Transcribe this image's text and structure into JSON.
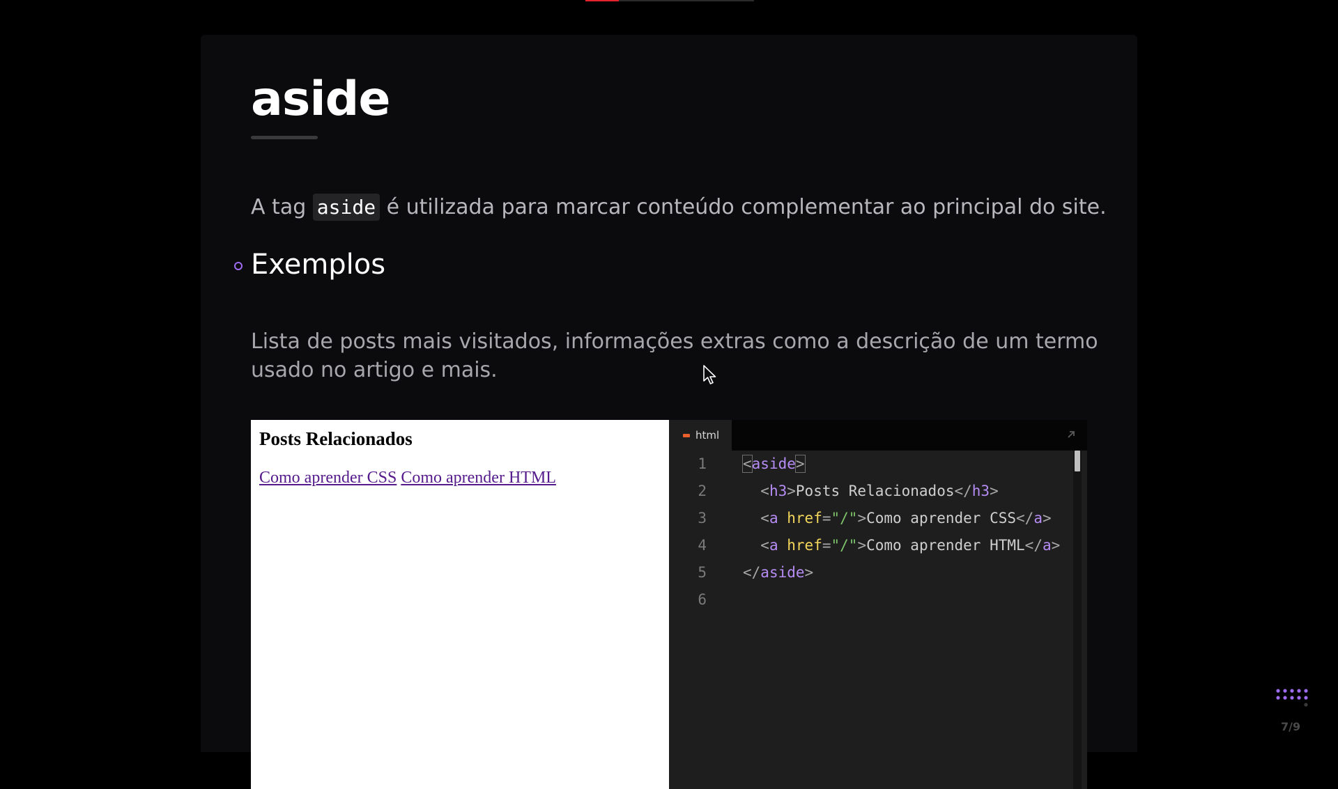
{
  "presentation": {
    "progress_fraction": 0.2,
    "accent_color": "#e5232d",
    "bullet_color": "#9d6cf0",
    "slide_counter": "7/9"
  },
  "slide": {
    "title": "aside",
    "intro_before": "A tag ",
    "intro_code": "aside",
    "intro_after": " é utilizada para marcar conteúdo complementar ao principal do site.",
    "section_heading": "Exemplos",
    "section_text": "Lista de posts mais visitados, informações extras como a descrição de um termo usado no artigo e mais."
  },
  "preview": {
    "heading": "Posts Relacionados",
    "links": [
      "Como aprender CSS",
      "Como aprender HTML"
    ]
  },
  "editor": {
    "tab_label": "html",
    "line_numbers": [
      "1",
      "2",
      "3",
      "4",
      "5",
      "6"
    ],
    "code": {
      "line1_tag": "aside",
      "line2_open_tag": "h3",
      "line2_text": "Posts Relacionados",
      "line2_close_tag": "h3",
      "line3_tag": "a",
      "line3_attr": "href",
      "line3_value": "\"/\"",
      "line3_text": "Como aprender CSS",
      "line3_close_tag": "a",
      "line4_tag": "a",
      "line4_attr": "href",
      "line4_value": "\"/\"",
      "line4_text": "Como aprender HTML",
      "line4_close_tag": "a",
      "line5_close_tag": "aside"
    }
  },
  "icons": {
    "expand": "expand-arrow-icon",
    "nav": "grid-dots-icon",
    "cursor": "mouse-pointer-icon"
  }
}
